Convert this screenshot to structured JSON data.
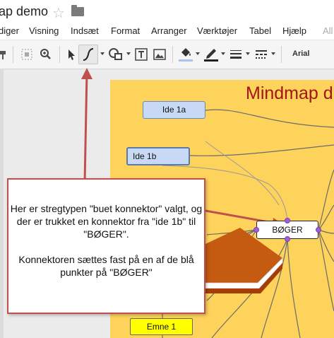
{
  "title_bar": {
    "doc_title": "ap demo"
  },
  "menu": {
    "items": [
      "diger",
      "Visning",
      "Indsæt",
      "Format",
      "Arranger",
      "Værktøjer",
      "Tabel",
      "Hjælp",
      "All"
    ]
  },
  "toolbar": {
    "font_label": "Arial",
    "tools": [
      "paint-format-icon",
      "select-frame-icon",
      "zoom-icon",
      "pointer-icon",
      "curved-connector-icon",
      "shape-icon",
      "textbox-icon",
      "image-icon",
      "fill-color-icon",
      "line-color-icon",
      "line-weight-icon",
      "line-dash-icon"
    ],
    "selected_tool": "curved-connector-icon",
    "colors": {
      "fill_underline": "#a7c4f0",
      "line_underline": "#222222"
    }
  },
  "canvas": {
    "title": "Mindmap d",
    "nodes": {
      "idea_1a": "Ide 1a",
      "idea_1b": "Ide 1b",
      "boger": "BØGER",
      "emne_1": "Emne 1"
    },
    "colors": {
      "page": "#fdd35b",
      "idea_node": "#c7d9f5",
      "topic_node": "#ffff00",
      "title": "#a31515",
      "handle": "#9f5fd6",
      "callout_border": "#c0504d"
    }
  },
  "callout": {
    "paragraph_1": "Her er stregtypen \"buet konnektor\" valgt, og der er trukket en konnektor fra \"ide 1b\" til \"BØGER\".",
    "paragraph_2": "Konnektoren sættes fast på en af de blå punkter på \"BØGER\""
  }
}
